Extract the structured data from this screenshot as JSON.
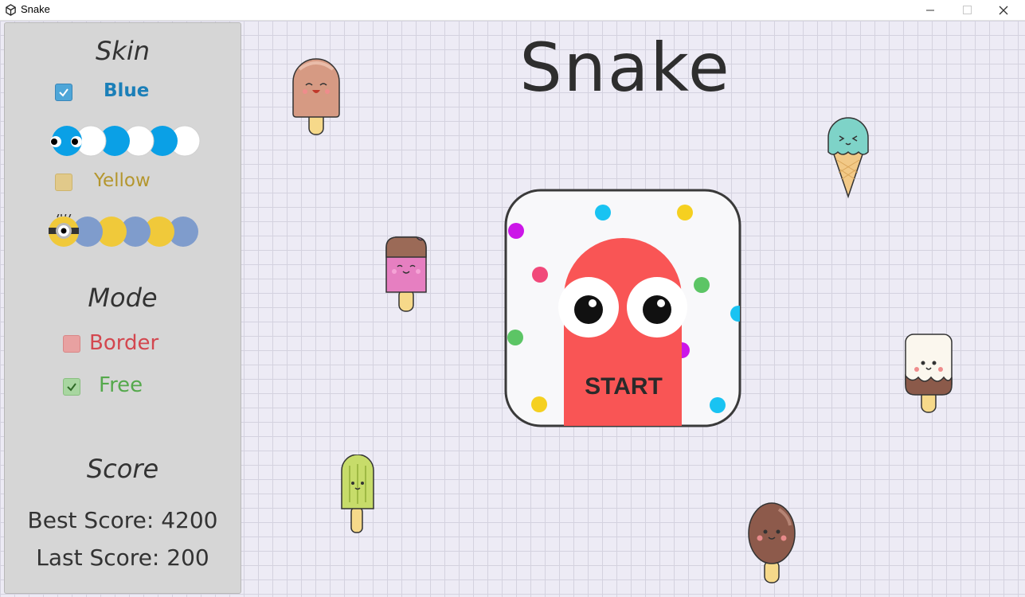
{
  "window": {
    "title": "Snake",
    "controls": [
      "minimize",
      "maximize",
      "close"
    ]
  },
  "sidebar": {
    "skin": {
      "heading": "Skin",
      "options": [
        {
          "label": "Blue",
          "checked": true,
          "color": "#1b7fb8"
        },
        {
          "label": "Yellow",
          "checked": false,
          "color": "#b4962e"
        }
      ]
    },
    "mode": {
      "heading": "Mode",
      "options": [
        {
          "label": "Border",
          "checked": false,
          "color": "#d3474f"
        },
        {
          "label": "Free",
          "checked": true,
          "color": "#55a94c"
        }
      ]
    },
    "score": {
      "heading": "Score",
      "best": "Best Score: 4200",
      "last": "Last Score: 200"
    }
  },
  "main": {
    "title": "Snake",
    "start_label": "START"
  },
  "colors": {
    "snake_red": "#f95555",
    "blue_skin": "#0aa0e6",
    "yellow_skin": "#f0c93a",
    "grey_blue_skin": "#7f9ccc",
    "background": "#edebf5"
  },
  "icons": [
    "unity-icon",
    "checkmark-icon",
    "popsicle-icon",
    "ice-cream-cone-icon"
  ]
}
